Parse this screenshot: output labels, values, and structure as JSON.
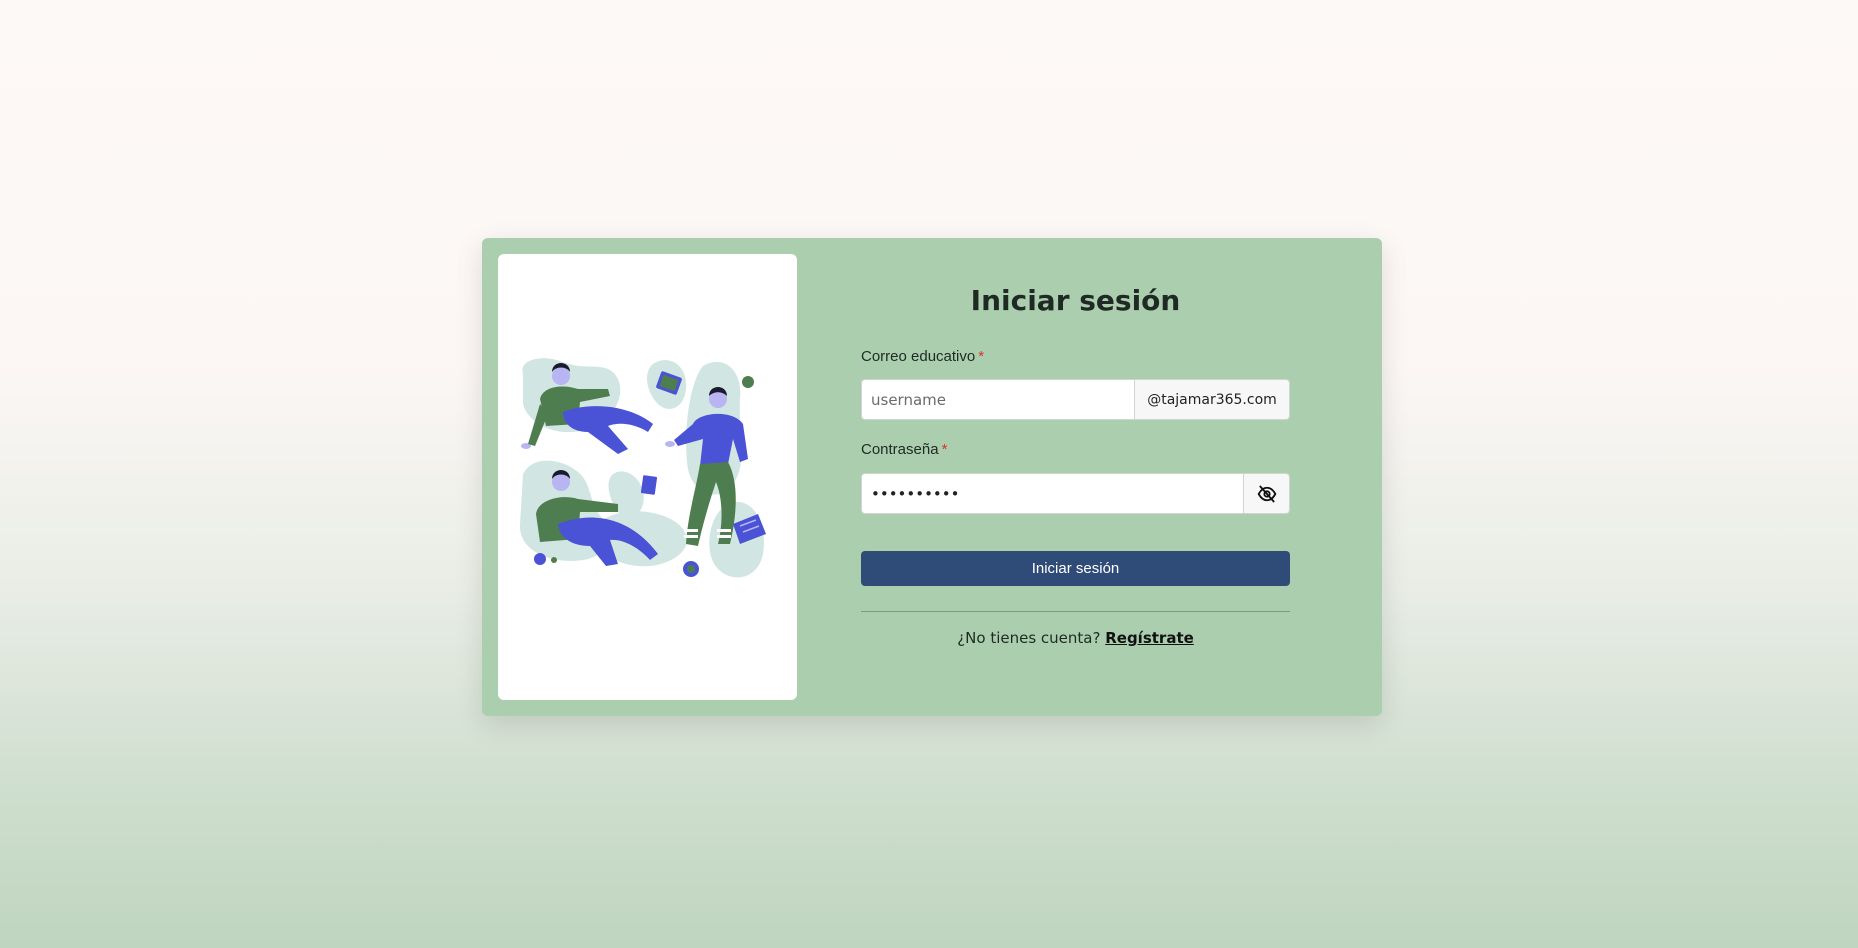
{
  "login": {
    "title": "Iniciar sesión",
    "email_label": "Correo educativo",
    "required_mark": "*",
    "email_placeholder": "username",
    "email_domain": "@tajamar365.com",
    "password_label": "Contraseña",
    "password_value": "••••••••••",
    "password_toggle_icon": "eye-slash-icon",
    "submit_label": "Iniciar sesión",
    "no_account_text": "¿No tienes cuenta?",
    "signup_link": "Regístrate"
  },
  "illustration": {
    "icon": "people-studying-illustration"
  },
  "colors": {
    "card_bg": "#abcfae",
    "button_bg": "#2f4b78",
    "required": "#d9342b",
    "illus_green": "#4e7e4f",
    "illus_blue": "#4a52d6",
    "illus_blob": "#d1e6e2"
  }
}
